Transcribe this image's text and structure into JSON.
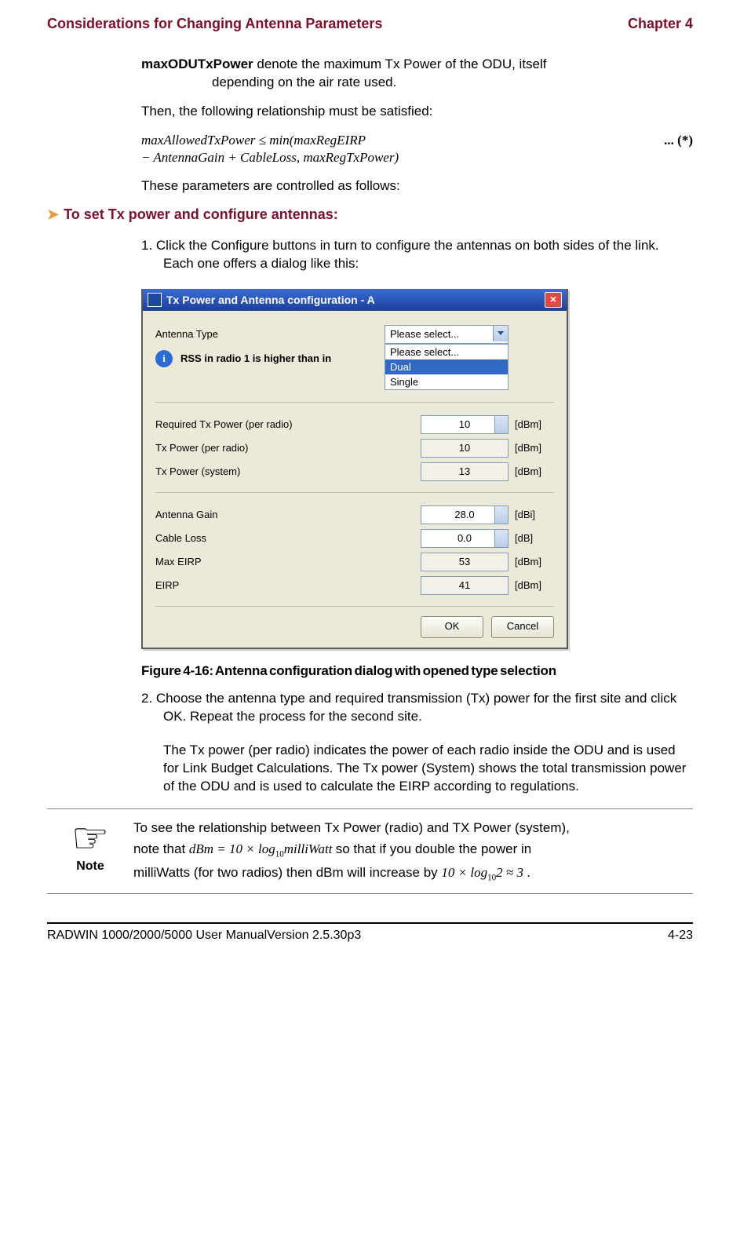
{
  "header": {
    "left": "Considerations for Changing Antenna Parameters",
    "right": "Chapter 4"
  },
  "def": {
    "term": "maxODUTxPower",
    "text_line1": " denote the maximum Tx Power of the ODU, itself",
    "text_line2": "depending on the air rate used."
  },
  "p_then": "Then, the following relationship must be satisfied:",
  "equation": {
    "line1": "maxAllowedTxPower ≤ min(maxRegEIRP",
    "line2": " − AntennaGain + CableLoss, maxRegTxPower)",
    "star": "... (*)"
  },
  "p_controlled": "These parameters are controlled as follows:",
  "section_lead": "To set Tx power and configure antennas:",
  "step1": "1. Click the Configure buttons in turn to configure the antennas on both sides of the link. Each one offers a dialog like this:",
  "dialog": {
    "title": "Tx Power and Antenna configuration - A",
    "antenna_type_label": "Antenna Type",
    "antenna_type_value": "Please select...",
    "options": [
      "Please select...",
      "Dual",
      "Single"
    ],
    "selected_option_index": 1,
    "info_text": "RSS in radio 1 is higher than in",
    "rows": {
      "req_tx": {
        "label": "Required Tx Power (per radio)",
        "value": "10",
        "unit": "[dBm]"
      },
      "tx_radio": {
        "label": "Tx Power (per radio)",
        "value": "10",
        "unit": "[dBm]"
      },
      "tx_system": {
        "label": "Tx Power (system)",
        "value": "13",
        "unit": "[dBm]"
      },
      "gain": {
        "label": "Antenna Gain",
        "value": "28.0",
        "unit": "[dBi]"
      },
      "loss": {
        "label": "Cable Loss",
        "value": "0.0",
        "unit": "[dB]"
      },
      "max_eirp": {
        "label": "Max EIRP",
        "value": "53",
        "unit": "[dBm]"
      },
      "eirp": {
        "label": "EIRP",
        "value": "41",
        "unit": "[dBm]"
      }
    },
    "ok": "OK",
    "cancel": "Cancel"
  },
  "figure_caption": "Figure 4-16: Antenna configuration dialog with opened type selection",
  "step2": "2. Choose the antenna type and required transmission (Tx) power for the first site and click OK. Repeat the process for the second site.",
  "step2b": "The Tx power (per radio) indicates the power of each radio inside the ODU and is used for Link Budget Calculations. The Tx power (System) shows the total transmission power of the ODU and is used to calculate the EIRP according to regulations.",
  "note": {
    "label": "Note",
    "line1_a": "To see the relationship between Tx Power (radio) and TX Power (system),",
    "line2_a": "note that ",
    "eq1": "dBm  =  10 × log",
    "eq1_sub": "10",
    "eq1_b": "milliWatt",
    "line2_b": " so that if you double the power in",
    "line3_a": "milliWatts (for two radios) then dBm will increase by ",
    "eq2": "10 × log",
    "eq2_sub": "10",
    "eq2_b": "2 ≈ 3",
    "line3_b": "."
  },
  "footer": {
    "left": "RADWIN 1000/2000/5000 User ManualVersion  2.5.30p3",
    "right": "4-23"
  }
}
